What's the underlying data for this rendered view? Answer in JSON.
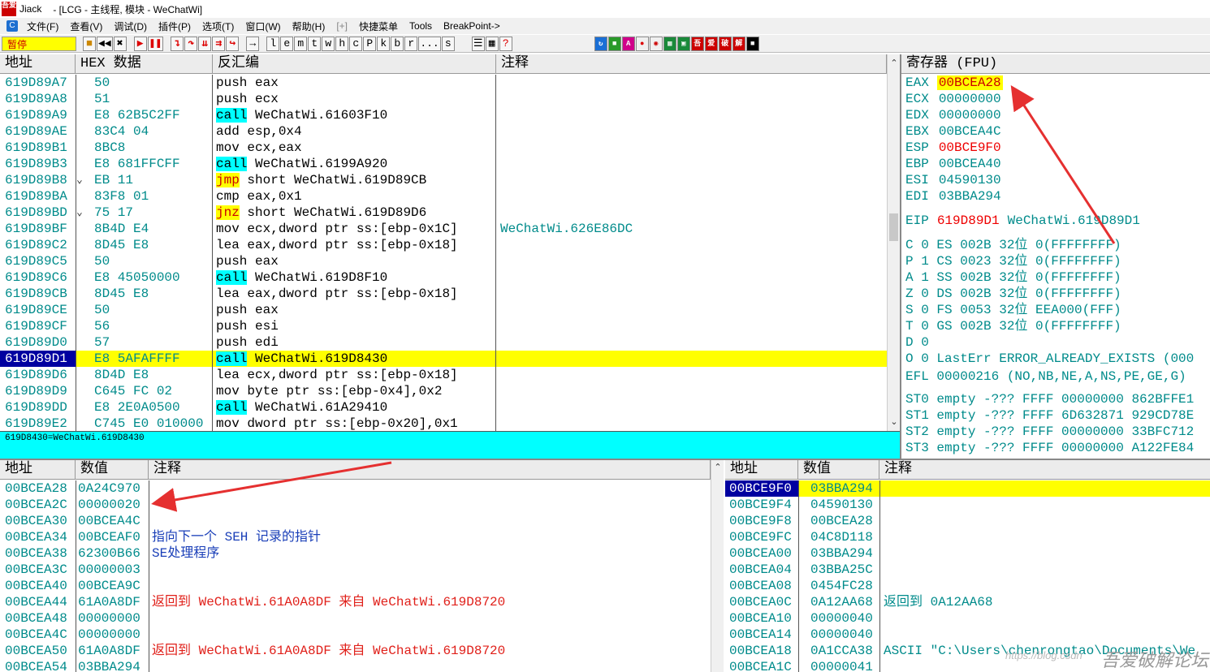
{
  "titlebar": {
    "app": "Jiack",
    "title": "- [LCG - 主线程, 模块 - WeChatWi]",
    "logo": "吾爱"
  },
  "menu": [
    "文件(F)",
    "查看(V)",
    "调试(D)",
    "插件(P)",
    "选项(T)",
    "窗口(W)",
    "帮助(H)",
    "[+]",
    "快捷菜单",
    "Tools",
    "BreakPoint->"
  ],
  "toolbar": {
    "pause_label": "暂停",
    "letters": [
      "l",
      "e",
      "m",
      "t",
      "w",
      "h",
      "c",
      "P",
      "k",
      "b",
      "r",
      "...",
      "s"
    ]
  },
  "disasm": {
    "headers": [
      "地址",
      "HEX 数据",
      "反汇编",
      "注释"
    ],
    "rows": [
      {
        "addr": "619D89A7",
        "jmp": "",
        "hex": "50",
        "kw": "",
        "asm": "push eax",
        "comment": ""
      },
      {
        "addr": "619D89A8",
        "jmp": "",
        "hex": "51",
        "kw": "",
        "asm": "push ecx",
        "comment": ""
      },
      {
        "addr": "619D89A9",
        "jmp": "",
        "hex": "E8 62B5C2FF",
        "kw": "call",
        "asm": " WeChatWi.61603F10",
        "comment": ""
      },
      {
        "addr": "619D89AE",
        "jmp": "",
        "hex": "83C4 04",
        "kw": "",
        "asm": "add esp,0x4",
        "comment": ""
      },
      {
        "addr": "619D89B1",
        "jmp": "",
        "hex": "8BC8",
        "kw": "",
        "asm": "mov ecx,eax",
        "comment": ""
      },
      {
        "addr": "619D89B3",
        "jmp": "",
        "hex": "E8 681FFCFF",
        "kw": "call",
        "asm": " WeChatWi.6199A920",
        "comment": ""
      },
      {
        "addr": "619D89B8",
        "jmp": "⌄",
        "hex": "EB 11",
        "kw": "jmp",
        "asm": " short WeChatWi.619D89CB",
        "comment": ""
      },
      {
        "addr": "619D89BA",
        "jmp": "",
        "hex": "83F8 01",
        "kw": "",
        "asm": "cmp eax,0x1",
        "comment": ""
      },
      {
        "addr": "619D89BD",
        "jmp": "⌄",
        "hex": "75 17",
        "kw": "jnz",
        "asm": " short WeChatWi.619D89D6",
        "comment": ""
      },
      {
        "addr": "619D89BF",
        "jmp": "",
        "hex": "8B4D E4",
        "kw": "",
        "asm": "mov ecx,dword ptr ss:[ebp-0x1C]",
        "comment": "WeChatWi.626E86DC"
      },
      {
        "addr": "619D89C2",
        "jmp": "",
        "hex": "8D45 E8",
        "kw": "",
        "asm": "lea eax,dword ptr ss:[ebp-0x18]",
        "comment": ""
      },
      {
        "addr": "619D89C5",
        "jmp": "",
        "hex": "50",
        "kw": "",
        "asm": "push eax",
        "comment": ""
      },
      {
        "addr": "619D89C6",
        "jmp": "",
        "hex": "E8 45050000",
        "kw": "call",
        "asm": " WeChatWi.619D8F10",
        "comment": ""
      },
      {
        "addr": "619D89CB",
        "jmp": "",
        "hex": "8D45 E8",
        "kw": "",
        "asm": "lea eax,dword ptr ss:[ebp-0x18]",
        "comment": ""
      },
      {
        "addr": "619D89CE",
        "jmp": "",
        "hex": "50",
        "kw": "",
        "asm": "push eax",
        "comment": ""
      },
      {
        "addr": "619D89CF",
        "jmp": "",
        "hex": "56",
        "kw": "",
        "asm": "push esi",
        "comment": ""
      },
      {
        "addr": "619D89D0",
        "jmp": "",
        "hex": "57",
        "kw": "",
        "asm": "push edi",
        "comment": ""
      },
      {
        "addr": "619D89D1",
        "jmp": "",
        "hex": "E8 5AFAFFFF",
        "kw": "call",
        "asm": " WeChatWi.619D8430",
        "comment": "",
        "selected": true
      },
      {
        "addr": "619D89D6",
        "jmp": "",
        "hex": "8D4D E8",
        "kw": "",
        "asm": "lea ecx,dword ptr ss:[ebp-0x18]",
        "comment": ""
      },
      {
        "addr": "619D89D9",
        "jmp": "",
        "hex": "C645 FC 02",
        "kw": "",
        "asm": "mov byte ptr ss:[ebp-0x4],0x2",
        "comment": ""
      },
      {
        "addr": "619D89DD",
        "jmp": "",
        "hex": "E8 2E0A0500",
        "kw": "call",
        "asm": " WeChatWi.61A29410",
        "comment": ""
      },
      {
        "addr": "619D89E2",
        "jmp": "",
        "hex": "C745 E0 010000",
        "kw": "",
        "asm": "mov dword ptr ss:[ebp-0x20],0x1",
        "comment": ""
      }
    ],
    "info": "619D8430=WeChatWi.619D8430"
  },
  "registers": {
    "header": "寄存器 (FPU)",
    "gp": [
      {
        "name": "EAX",
        "value": "00BCEA28",
        "style": "hl"
      },
      {
        "name": "ECX",
        "value": "00000000",
        "style": ""
      },
      {
        "name": "EDX",
        "value": "00000000",
        "style": ""
      },
      {
        "name": "EBX",
        "value": "00BCEA4C",
        "style": ""
      },
      {
        "name": "ESP",
        "value": "00BCE9F0",
        "style": "red"
      },
      {
        "name": "EBP",
        "value": "00BCEA40",
        "style": ""
      },
      {
        "name": "ESI",
        "value": "04590130",
        "style": ""
      },
      {
        "name": "EDI",
        "value": "03BBA294",
        "style": ""
      }
    ],
    "eip": {
      "name": "EIP",
      "value": "619D89D1",
      "desc": "WeChatWi.619D89D1"
    },
    "flags": [
      "C 0  ES 002B 32位 0(FFFFFFFF)",
      "P 1  CS 0023 32位 0(FFFFFFFF)",
      "A 1  SS 002B 32位 0(FFFFFFFF)",
      "Z 0  DS 002B 32位 0(FFFFFFFF)",
      "S 0  FS 0053 32位 EEA000(FFF)",
      "T 0  GS 002B 32位 0(FFFFFFFF)",
      "D 0",
      "O 0  LastErr ERROR_ALREADY_EXISTS (000"
    ],
    "efl": "EFL 00000216 (NO,NB,NE,A,NS,PE,GE,G)",
    "fpu": [
      "ST0 empty -??? FFFF 00000000 862BFFE1",
      "ST1 empty -??? FFFF 6D632871 929CD78E",
      "ST2 empty -??? FFFF 00000000 33BFC712",
      "ST3 empty -??? FFFF 00000000 A122FE84"
    ]
  },
  "dump": {
    "headers": [
      "地址",
      "数值",
      "注释"
    ],
    "rows": [
      {
        "addr": "00BCEA28",
        "val": "0A24C970",
        "comment": "",
        "ctype": ""
      },
      {
        "addr": "00BCEA2C",
        "val": "00000020",
        "comment": "",
        "ctype": ""
      },
      {
        "addr": "00BCEA30",
        "val": "00BCEA4C",
        "comment": "",
        "ctype": ""
      },
      {
        "addr": "00BCEA34",
        "val": "00BCEAF0",
        "comment": "指向下一个 SEH 记录的指针",
        "ctype": "blue"
      },
      {
        "addr": "00BCEA38",
        "val": "62300B66",
        "comment": "SE处理程序",
        "ctype": "blue"
      },
      {
        "addr": "00BCEA3C",
        "val": "00000003",
        "comment": "",
        "ctype": ""
      },
      {
        "addr": "00BCEA40",
        "val": "00BCEA9C",
        "comment": "",
        "ctype": ""
      },
      {
        "addr": "00BCEA44",
        "val": "61A0A8DF",
        "comment": "返回到 WeChatWi.61A0A8DF 来自 WeChatWi.619D8720",
        "ctype": "red"
      },
      {
        "addr": "00BCEA48",
        "val": "00000000",
        "comment": "",
        "ctype": ""
      },
      {
        "addr": "00BCEA4C",
        "val": "00000000",
        "comment": "",
        "ctype": ""
      },
      {
        "addr": "00BCEA50",
        "val": "61A0A8DF",
        "comment": "返回到 WeChatWi.61A0A8DF 来自 WeChatWi.619D8720",
        "ctype": "red"
      },
      {
        "addr": "00BCEA54",
        "val": "03BBA294",
        "comment": "",
        "ctype": ""
      }
    ]
  },
  "stack": {
    "headers": [
      "地址",
      "数值",
      "注释"
    ],
    "rows": [
      {
        "addr": "00BCE9F0",
        "val": "03BBA294",
        "comment": "",
        "selected": true
      },
      {
        "addr": "00BCE9F4",
        "val": "04590130",
        "comment": ""
      },
      {
        "addr": "00BCE9F8",
        "val": "00BCEA28",
        "comment": ""
      },
      {
        "addr": "00BCE9FC",
        "val": "04C8D118",
        "comment": ""
      },
      {
        "addr": "00BCEA00",
        "val": "03BBA294",
        "comment": ""
      },
      {
        "addr": "00BCEA04",
        "val": "03BBA25C",
        "comment": ""
      },
      {
        "addr": "00BCEA08",
        "val": "0454FC28",
        "comment": ""
      },
      {
        "addr": "00BCEA0C",
        "val": "0A12AA68",
        "comment": "返回到 0A12AA68",
        "ctype": "teal"
      },
      {
        "addr": "00BCEA10",
        "val": "00000040",
        "comment": ""
      },
      {
        "addr": "00BCEA14",
        "val": "00000040",
        "comment": ""
      },
      {
        "addr": "00BCEA18",
        "val": "0A1CCA38",
        "comment": "ASCII \"C:\\Users\\chenrongtao\\Documents\\We",
        "ctype": "teal"
      },
      {
        "addr": "00BCEA1C",
        "val": "00000041",
        "comment": ""
      }
    ]
  },
  "watermark": {
    "forum": "吾爱破解论坛",
    "url": "https://blog.csdn"
  }
}
